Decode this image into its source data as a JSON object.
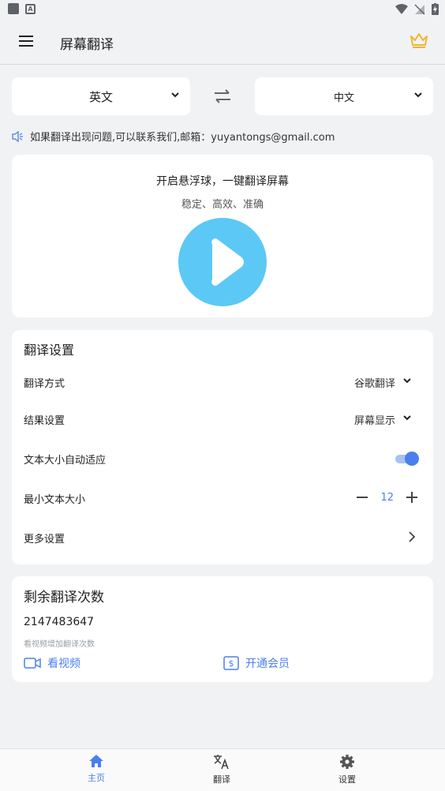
{
  "app_bar": {
    "title": "屏幕翻译"
  },
  "languages": {
    "source": "英文",
    "target": "中文"
  },
  "notice": {
    "text": "如果翻译出现问题,可以联系我们,邮箱：yuyantongs@gmail.com"
  },
  "hero": {
    "title": "开启悬浮球，一键翻译屏幕",
    "subtitle": "稳定、高效、准确"
  },
  "settings": {
    "title": "翻译设置",
    "method": {
      "label": "翻译方式",
      "value": "谷歌翻译"
    },
    "result": {
      "label": "结果设置",
      "value": "屏幕显示"
    },
    "auto_fit": {
      "label": "文本大小自动适应",
      "enabled": true
    },
    "min_size": {
      "label": "最小文本大小",
      "value": "12"
    },
    "more": {
      "label": "更多设置"
    }
  },
  "quota": {
    "title": "剩余翻译次数",
    "count": "2147483647",
    "hint": "看视频增加翻译次数",
    "watch_video": "看视频",
    "vip": "开通会员"
  },
  "bottom_nav": [
    {
      "label": "主页",
      "active": true
    },
    {
      "label": "翻译",
      "active": false
    },
    {
      "label": "设置",
      "active": false
    }
  ],
  "colors": {
    "accent": "#4a80ed",
    "play": "#5bc8f5",
    "crown": "#f2b531"
  }
}
